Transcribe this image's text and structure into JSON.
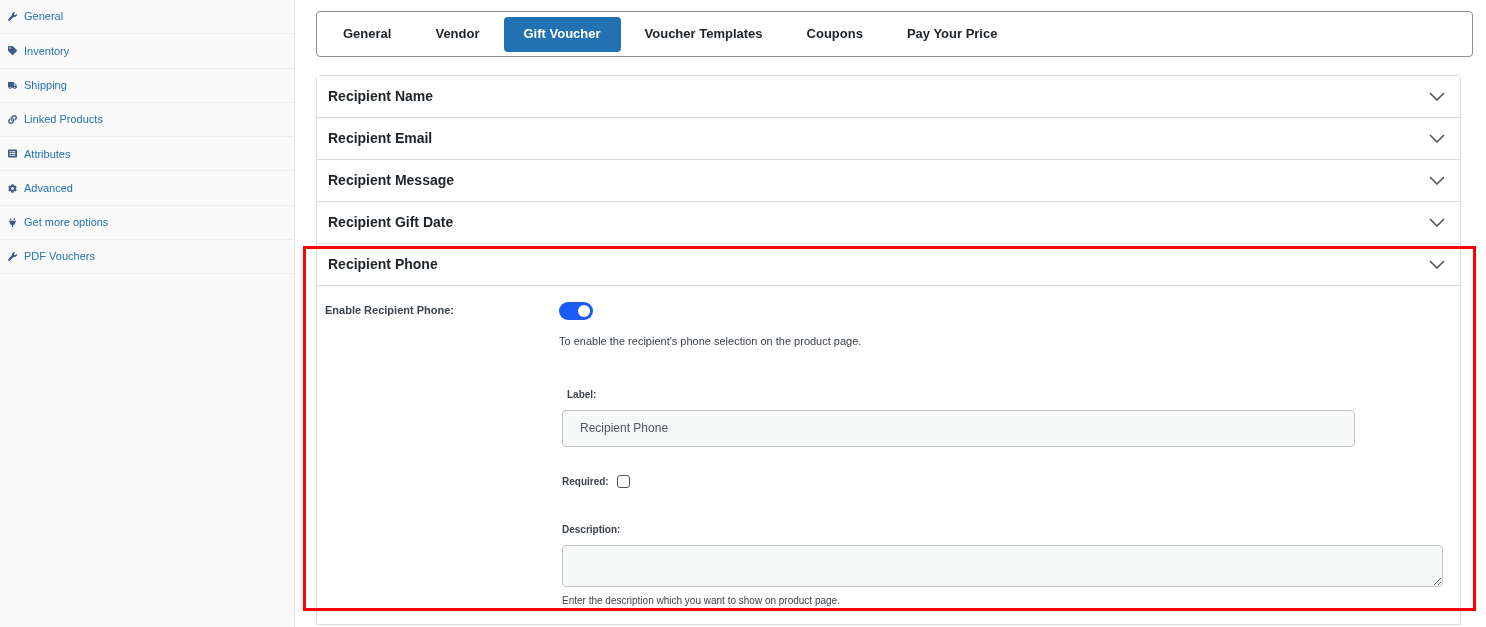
{
  "sidebar": {
    "items": [
      {
        "label": "General"
      },
      {
        "label": "Inventory"
      },
      {
        "label": "Shipping"
      },
      {
        "label": "Linked Products"
      },
      {
        "label": "Attributes"
      },
      {
        "label": "Advanced"
      },
      {
        "label": "Get more options"
      },
      {
        "label": "PDF Vouchers"
      }
    ]
  },
  "tabs": [
    {
      "label": "General",
      "selected": false
    },
    {
      "label": "Vendor",
      "selected": false
    },
    {
      "label": "Gift Voucher",
      "selected": true
    },
    {
      "label": "Voucher Templates",
      "selected": false
    },
    {
      "label": "Coupons",
      "selected": false
    },
    {
      "label": "Pay Your Price",
      "selected": false
    }
  ],
  "sections": [
    {
      "title": "Recipient Name"
    },
    {
      "title": "Recipient Email"
    },
    {
      "title": "Recipient Message"
    },
    {
      "title": "Recipient Gift Date"
    },
    {
      "title": "Recipient Phone",
      "fields": {
        "enable_label": "Enable Recipient Phone:",
        "enable_on": true,
        "enable_help": "To enable the recipient's phone selection on the product page.",
        "label_label": "Label:",
        "label_value": "Recipient Phone",
        "required_label": "Required:",
        "required_checked": false,
        "description_label": "Description:",
        "description_help": "Enter the description which you want to show on product page."
      }
    }
  ]
}
